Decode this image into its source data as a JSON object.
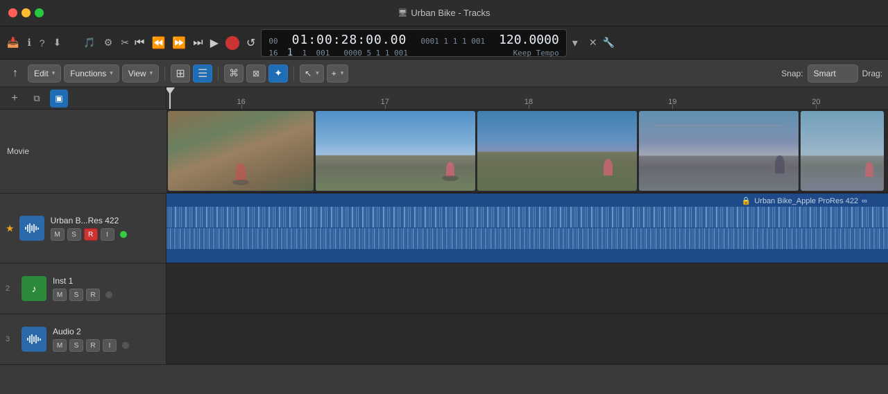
{
  "window": {
    "title": "Urban Bike - Tracks",
    "icon": "🖥"
  },
  "transport": {
    "time_main": "01:00:28:00.00",
    "time_sub1": "00",
    "beat_top": "0001  1  1  1  001",
    "beat_val": "1",
    "beat_bottom": "0000  5  1  1  001",
    "beat_bottom_big": "1",
    "tempo": "120.0000",
    "tempo_label": "Keep Tempo"
  },
  "toolbar": {
    "edit_label": "Edit",
    "functions_label": "Functions",
    "view_label": "View",
    "snap_label": "Snap:",
    "snap_value": "Smart",
    "drag_label": "Drag:"
  },
  "tracks": {
    "movie_label": "Movie",
    "track1": {
      "name": "Urban B...Res 422",
      "controls": [
        "M",
        "S",
        "R",
        "I"
      ],
      "has_star": true,
      "has_led": true,
      "led_on": true,
      "number": ""
    },
    "track2": {
      "name": "Inst 1",
      "controls": [
        "M",
        "S",
        "R"
      ],
      "has_star": false,
      "has_led": true,
      "led_on": false,
      "number": "2"
    },
    "track3": {
      "name": "Audio 2",
      "controls": [
        "M",
        "S",
        "R",
        "I"
      ],
      "has_star": false,
      "has_led": true,
      "led_on": false,
      "number": "3"
    }
  },
  "timeline": {
    "ruler_marks": [
      "16",
      "17",
      "18",
      "19",
      "20"
    ],
    "audio_clip_label": "Urban Bike_Apple ProRes 422"
  },
  "icons": {
    "close": "✕",
    "wrench": "⚙",
    "grid": "⊞",
    "list": "≡",
    "magnet": "⌘",
    "scissors": "✂",
    "play": "▶",
    "record": "●",
    "rewind": "◀◀",
    "fast_forward": "▶▶",
    "skip_back": "⏮",
    "skip_end": "⏭",
    "cycle": "↺",
    "arrow_tool": "↖",
    "chevron_down": "▾",
    "plus": "+",
    "lock": "🔒",
    "infinity": "∞"
  }
}
